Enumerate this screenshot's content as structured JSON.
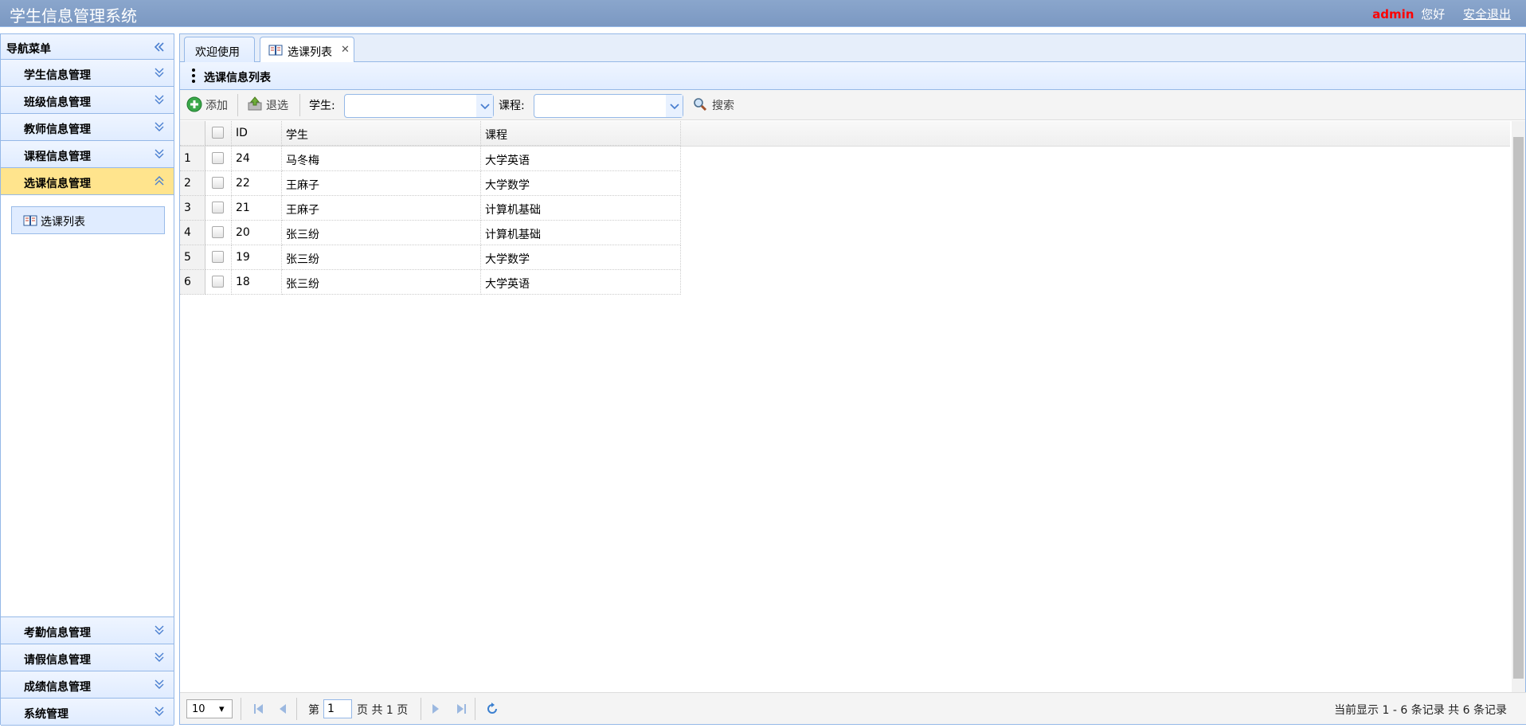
{
  "header": {
    "title": "学生信息管理系统",
    "user": "admin",
    "greeting": "您好",
    "logout": "安全退出"
  },
  "sidebar": {
    "title": "导航菜单",
    "items_top": [
      {
        "label": "学生信息管理"
      },
      {
        "label": "班级信息管理"
      },
      {
        "label": "教师信息管理"
      },
      {
        "label": "课程信息管理"
      },
      {
        "label": "选课信息管理"
      }
    ],
    "sub_items": [
      {
        "label": "选课列表"
      }
    ],
    "items_bottom": [
      {
        "label": "考勤信息管理"
      },
      {
        "label": "请假信息管理"
      },
      {
        "label": "成绩信息管理"
      },
      {
        "label": "系统管理"
      }
    ]
  },
  "tabs": [
    {
      "label": "欢迎使用"
    },
    {
      "label": "选课列表"
    }
  ],
  "panel": {
    "title": "选课信息列表"
  },
  "toolbar": {
    "add": "添加",
    "withdraw": "退选",
    "student_label": "学生:",
    "course_label": "课程:",
    "search": "搜索"
  },
  "table": {
    "columns": [
      "ID",
      "学生",
      "课程"
    ],
    "rows": [
      {
        "n": "1",
        "id": "24",
        "student": "马冬梅",
        "course": "大学英语"
      },
      {
        "n": "2",
        "id": "22",
        "student": "王麻子",
        "course": "大学数学"
      },
      {
        "n": "3",
        "id": "21",
        "student": "王麻子",
        "course": "计算机基础"
      },
      {
        "n": "4",
        "id": "20",
        "student": "张三纷",
        "course": "计算机基础"
      },
      {
        "n": "5",
        "id": "19",
        "student": "张三纷",
        "course": "大学数学"
      },
      {
        "n": "6",
        "id": "18",
        "student": "张三纷",
        "course": "大学英语"
      }
    ]
  },
  "pager": {
    "page_size": "10",
    "page_prefix": "第",
    "page": "1",
    "page_suffix": "页 共 1 页",
    "summary": "当前显示 1 - 6 条记录 共 6 条记录"
  },
  "colors": {
    "header": "#7b98c2",
    "border": "#95b8e7",
    "accent_active": "#ffe48d",
    "admin": "#ff0000"
  }
}
